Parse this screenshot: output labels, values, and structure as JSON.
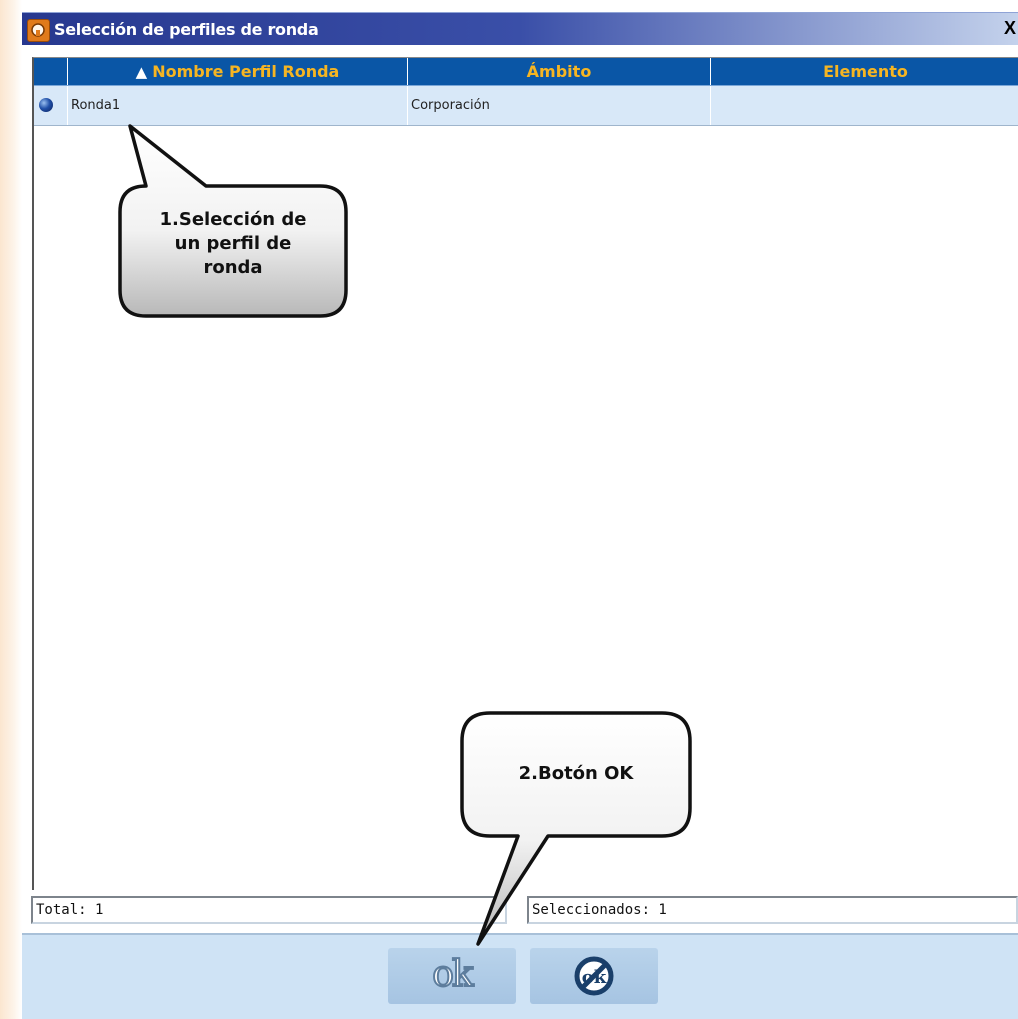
{
  "window": {
    "title": "Selección de perfiles de ronda",
    "close_label": "X"
  },
  "grid": {
    "sort_icon": "triangle-up-icon",
    "columns": [
      "",
      "Nombre Perfil Ronda",
      "Ámbito",
      "Elemento"
    ],
    "rows": [
      {
        "status_icon": "blue-ball-icon",
        "nombre": "Ronda1",
        "ambito": "Corporación",
        "elemento": ""
      }
    ]
  },
  "footer": {
    "total": "Total: 1",
    "selected": "Seleccionados: 1"
  },
  "buttons": {
    "ok_label": "ok",
    "cancel_icon": "cancel-ok-icon"
  },
  "callouts": {
    "step1_line1": "1.Selección de",
    "step1_line2": "un perfil de",
    "step1_line3": "ronda",
    "step2": "2.Botón OK"
  },
  "colors": {
    "titlebar": "#27388f",
    "header_bg": "#0a56a6",
    "header_text": "#f6b522",
    "row_bg": "#d8e8f8",
    "buttonbar": "#cfe3f5"
  }
}
